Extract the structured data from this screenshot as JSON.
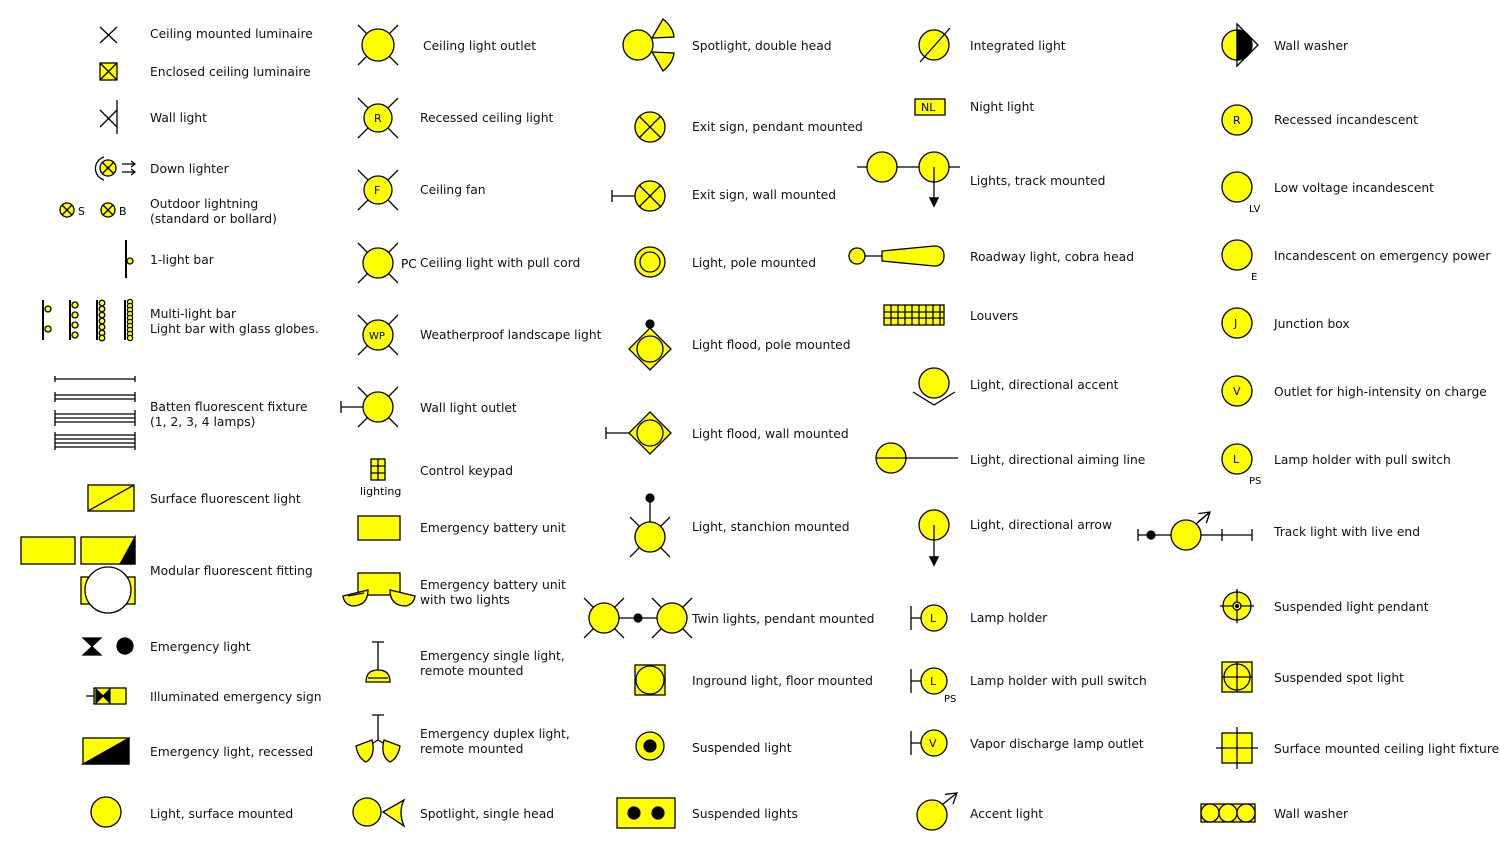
{
  "colors": {
    "symbol_fill": "#FFFF00",
    "stroke": "#000000"
  },
  "col1": [
    "Ceiling mounted luminaire",
    "Enclosed ceiling luminaire",
    "Wall light",
    "Down lighter",
    "Outdoor lightning\n(standard or bollard)",
    "1-light bar",
    "Multi-light bar\nLight bar with glass globes.",
    "Batten fluorescent fixture\n(1, 2, 3, 4 lamps)",
    "Surface fluorescent light",
    "Modular fluorescent fitting",
    "Emergency light",
    "Illuminated emergency sign",
    "Emergency light, recessed",
    "Light, surface mounted"
  ],
  "col2": [
    "Ceiling light outlet",
    "Recessed ceiling light",
    "Ceiling fan",
    "Ceiling light with pull cord",
    "Weatherproof landscape light",
    "Wall light outlet",
    "Control keypad",
    "Emergency battery unit",
    "Emergency battery unit\nwith two lights",
    "Emergency single light,\nremote mounted",
    "Emergency duplex light,\nremote mounted",
    "Spotlight, single head"
  ],
  "col3": [
    "Spotlight, double head",
    "Exit sign, pendant mounted",
    "Exit sign, wall mounted",
    "Light, pole mounted",
    "Light flood, pole mounted",
    "Light flood, wall mounted",
    "Light, stanchion mounted",
    "Twin lights, pendant mounted",
    "Inground light, floor mounted",
    "Suspended light",
    "Suspended lights"
  ],
  "col4": [
    "Integrated light",
    "Night light",
    "Lights, track mounted",
    "Roadway light, cobra head",
    "Louvers",
    "Light, directional accent",
    "Light, directional aiming line",
    "Light, directional arrow",
    "Lamp holder",
    "Lamp holder with pull switch",
    "Vapor discharge lamp outlet",
    "Accent light"
  ],
  "col5": [
    "Wall washer",
    "Recessed incandescent",
    "Low voltage incandescent",
    "Incandescent on emergency power",
    "Junction box",
    "Outlet for high-intensity on charge",
    "Lamp holder with pull switch",
    "Track light with live end",
    "Suspended light pendant",
    "Suspended spot light",
    "Surface mounted ceiling light fixture",
    "Wall washer"
  ],
  "symbol_text": {
    "S": "S",
    "B": "B",
    "R": "R",
    "F": "F",
    "PC": "PC",
    "WP": "WP",
    "lighting": "lighting",
    "NL": "NL",
    "L": "L",
    "PS": "PS",
    "V": "V",
    "LV": "LV",
    "E": "E",
    "J": "J"
  }
}
